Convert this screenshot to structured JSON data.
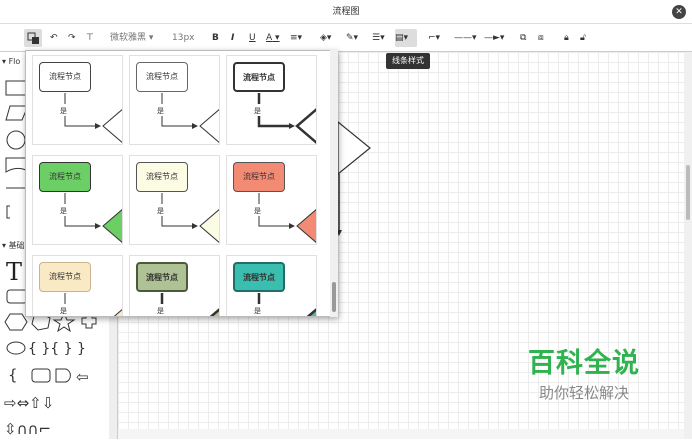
{
  "window": {
    "title": "流程图"
  },
  "toolbar": {
    "font_family": "微软雅黑",
    "font_size": "13px",
    "bold": "B",
    "italic": "I",
    "underline": "U",
    "font_color": "A",
    "tooltip": "线条样式"
  },
  "sidebar": {
    "section1": "Flo",
    "section2": "基础"
  },
  "popup": {
    "cells": [
      {
        "label": "流程节点",
        "yes": "是",
        "fill": "#ffffff",
        "stroke": "#444444",
        "tri": "#ffffff",
        "thick": false
      },
      {
        "label": "流程节点",
        "yes": "是",
        "fill": "#ffffff",
        "stroke": "#666666",
        "tri": "#ffffff",
        "thick": false
      },
      {
        "label": "流程节点",
        "yes": "是",
        "fill": "#ffffff",
        "stroke": "#333333",
        "tri": "#ffffff",
        "thick": true
      },
      {
        "label": "流程节点",
        "yes": "是",
        "fill": "#6ccf66",
        "stroke": "#333333",
        "tri": "#6ccf66",
        "thick": false
      },
      {
        "label": "流程节点",
        "yes": "是",
        "fill": "#fcfbe4",
        "stroke": "#555555",
        "tri": "#fcfbe4",
        "thick": false
      },
      {
        "label": "流程节点",
        "yes": "是",
        "fill": "#f28a74",
        "stroke": "#555555",
        "tri": "#f28a74",
        "thick": false
      },
      {
        "label": "流程节点",
        "yes": "是",
        "fill": "#f9e9c4",
        "stroke": "#c8b48c",
        "tri": "#f9e9c4",
        "thick": false
      },
      {
        "label": "流程节点",
        "yes": "是",
        "fill": "#aec295",
        "stroke": "#4a5a3a",
        "tri": "#aec295",
        "thick": true
      },
      {
        "label": "流程节点",
        "yes": "是",
        "fill": "#3bbdb0",
        "stroke": "#1f6f68",
        "tri": "#3bbdb0",
        "thick": true
      }
    ]
  },
  "watermark": {
    "line1": "百科全说",
    "line2": "助你轻松解决"
  }
}
